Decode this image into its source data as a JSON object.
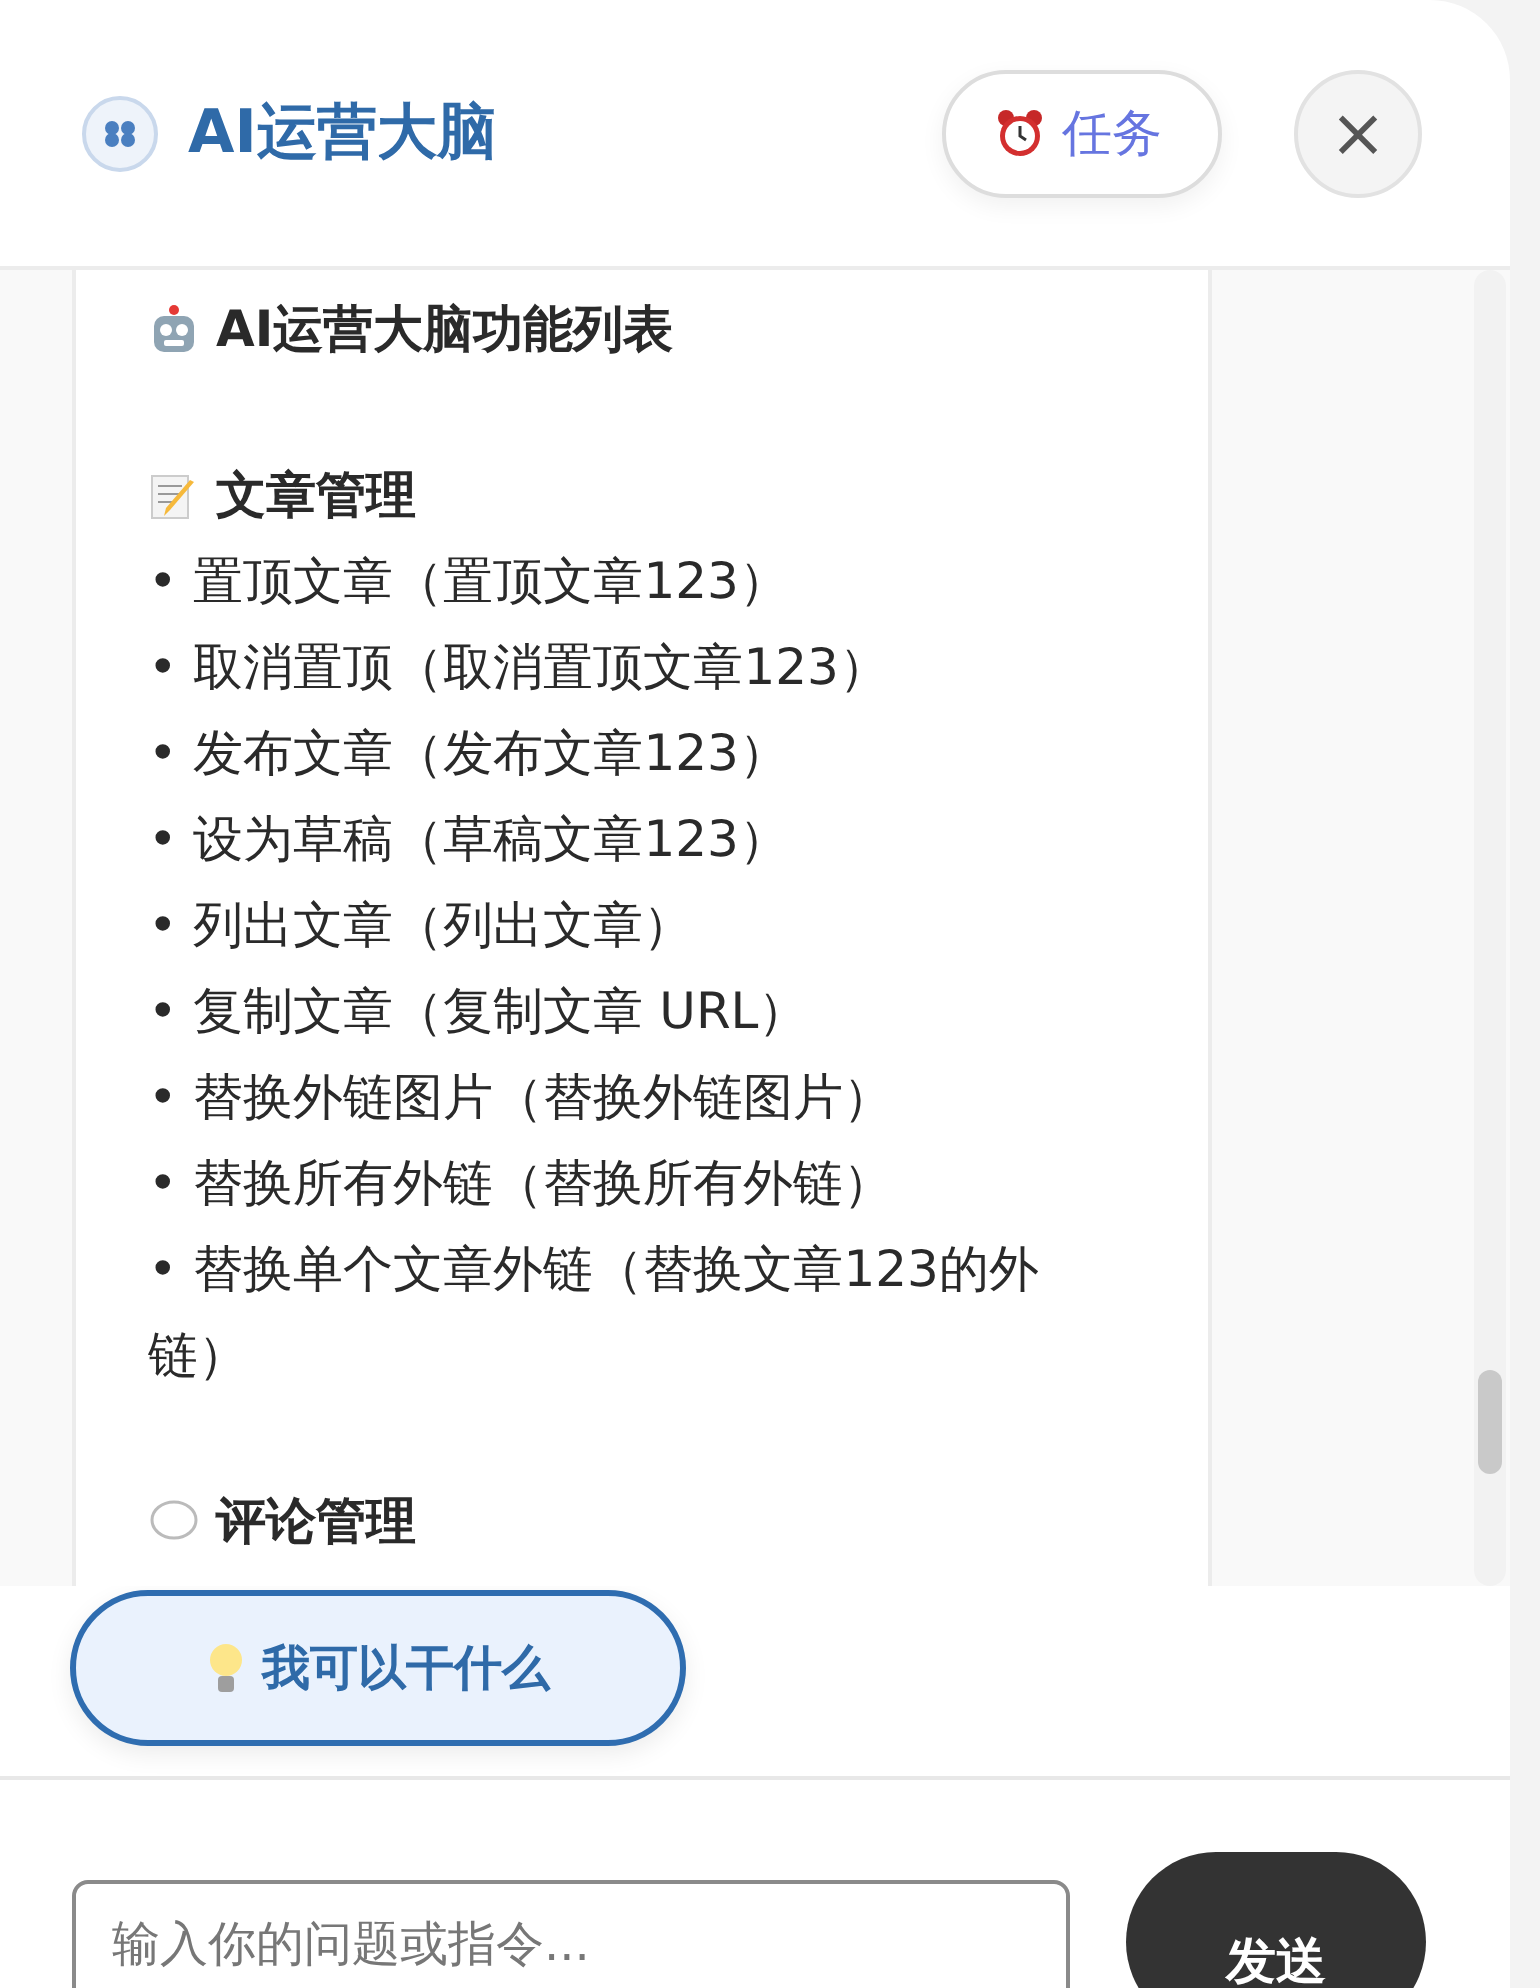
{
  "header": {
    "title": "AI运营大脑",
    "task_button": "任务",
    "close_button": "×"
  },
  "message": {
    "title": "AI运营大脑功能列表",
    "sections": [
      {
        "kind": "memo",
        "heading": "文章管理",
        "items": [
          "• 置顶文章（置顶文章123）",
          "• 取消置顶（取消置顶文章123）",
          "• 发布文章（发布文章123）",
          "• 设为草稿（草稿文章123）",
          "• 列出文章（列出文章）",
          "• 复制文章（复制文章 URL）",
          "• 替换外链图片（替换外链图片）",
          "• 替换所有外链（替换所有外链）",
          "• 替换单个文章外链（替换文章123的外链）"
        ]
      },
      {
        "kind": "comment",
        "heading": "评论管理"
      }
    ]
  },
  "suggestion": "我可以干什么",
  "input": {
    "placeholder": "输入你的问题或指令..."
  },
  "send_button": "发送"
}
